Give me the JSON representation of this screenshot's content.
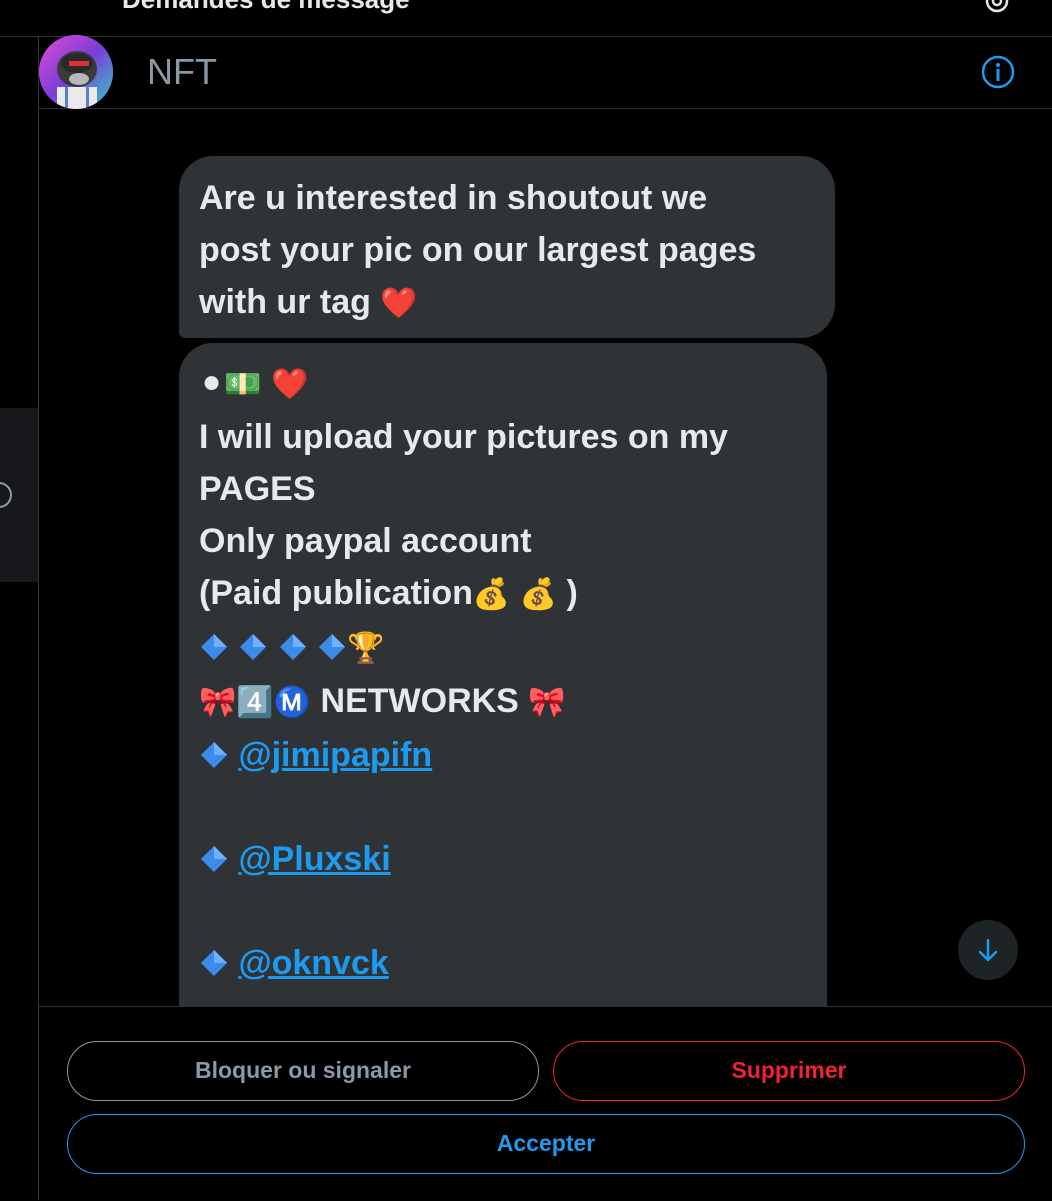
{
  "top_header": {
    "title": "Demandes de message"
  },
  "conversation": {
    "name": "NFT"
  },
  "messages": {
    "first": {
      "lines": [
        "Are u interested in shoutout we",
        "post your pic on our largest pages",
        "with ur tag"
      ],
      "heart": "❤️"
    },
    "second": {
      "emoji_line": [
        "⚫",
        "💵",
        "❤️"
      ],
      "lines": [
        "I will upload your pictures on my",
        "PAGES",
        "Only paypal account",
        "(Paid publication"
      ],
      "money_bags": [
        "💰",
        "💰"
      ],
      "paren_close": ")",
      "trophy": "🏆",
      "ribbon": "🎀",
      "keycap": "4️⃣",
      "metro": "Ⓜ️",
      "networks": "NETWORKS",
      "mentions": [
        "@jimipapifn",
        "@Pluxski",
        "@oknvck"
      ]
    }
  },
  "actions": {
    "block_label": "Bloquer ou signaler",
    "delete_label": "Supprimer",
    "accept_label": "Accepter"
  },
  "colors": {
    "accent": "#1d9bf0",
    "danger": "#f4212e",
    "bubble": "#2f3336",
    "muted": "#8b98a5",
    "background": "#000000"
  },
  "icons": [
    "gear-icon",
    "info-icon",
    "arrow-down-icon",
    "blue-diamond-icon"
  ]
}
